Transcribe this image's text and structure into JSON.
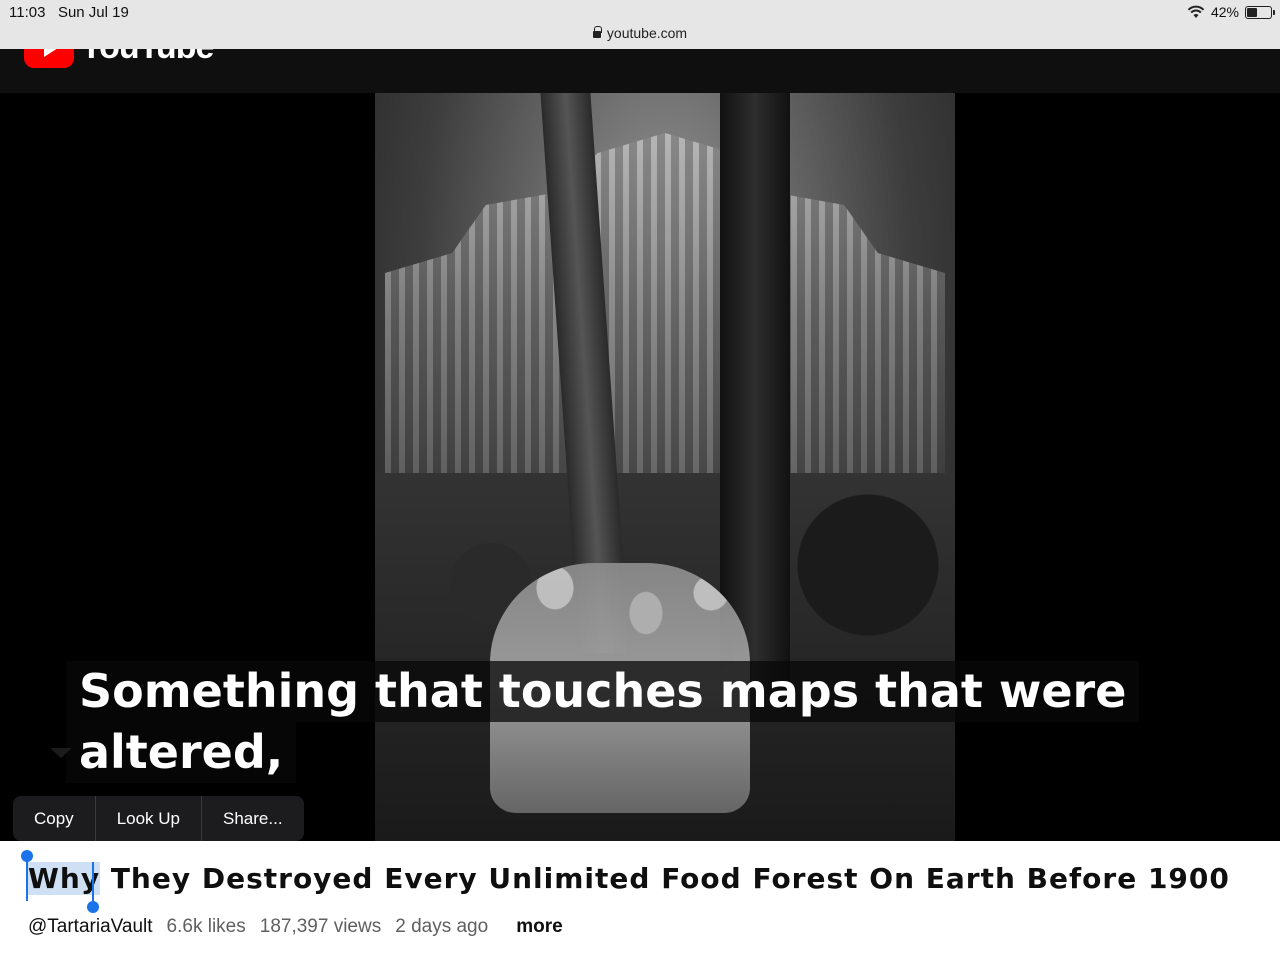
{
  "status_bar": {
    "time": "11:03",
    "date": "Sun Jul 19",
    "url": "youtube.com",
    "battery": "42%",
    "battery_level": 0.42
  },
  "header": {
    "logo_text": "YouTube"
  },
  "video": {
    "caption_line_1": "Something that touches maps that were",
    "caption_line_2": "altered,"
  },
  "context_menu": {
    "items": [
      "Copy",
      "Look Up",
      "Share..."
    ]
  },
  "title": {
    "selected": "Why",
    "rest": " They Destroyed Every Unlimited Food Forest On Earth Before 1900"
  },
  "meta": {
    "channel": "@TartariaVault",
    "likes": "6.6k likes",
    "views": "187,397 views",
    "age": "2 days ago",
    "more": "more"
  },
  "colors": {
    "brand_red": "#ff0000",
    "selection": "#cfe0f5",
    "handle": "#1a73e8"
  }
}
